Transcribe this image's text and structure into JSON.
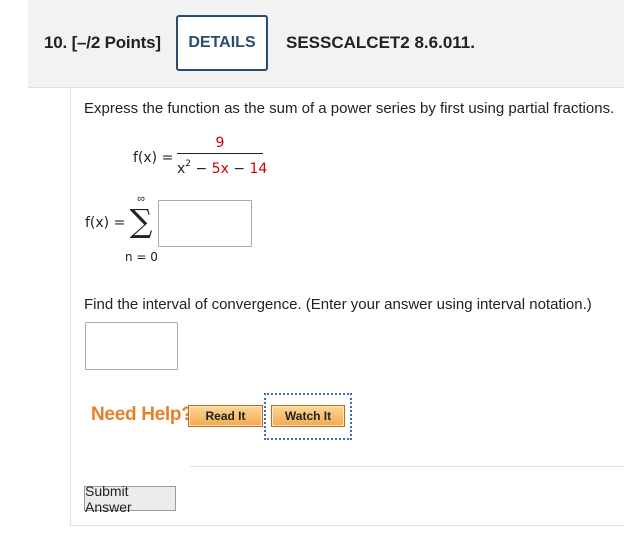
{
  "question": {
    "number": "10.",
    "points": "[–/2 Points]",
    "details_label": "DETAILS",
    "code": "SESSCALCET2 8.6.011."
  },
  "problem": {
    "prompt": "Express the function as the sum of a power series by first using partial fractions.",
    "fx_label": "f(x) =",
    "numerator": "9",
    "denominator": {
      "x": "x",
      "exp": "2",
      "minus1": " − ",
      "coef": "5x",
      "minus2": " − ",
      "const": "14"
    },
    "series_label": "f(x) =",
    "sigma": "∑",
    "upper_limit": "∞",
    "lower_limit": "n = 0",
    "series_answer": "",
    "interval_prompt": "Find the interval of convergence. (Enter your answer using interval notation.)",
    "interval_answer": ""
  },
  "help": {
    "label": "Need Help?",
    "read": "Read It",
    "watch": "Watch It"
  },
  "submit": "Submit Answer",
  "colors": {
    "accent_red": "#d00000",
    "help_orange": "#e8802a",
    "details_border": "#2a4d6e"
  }
}
